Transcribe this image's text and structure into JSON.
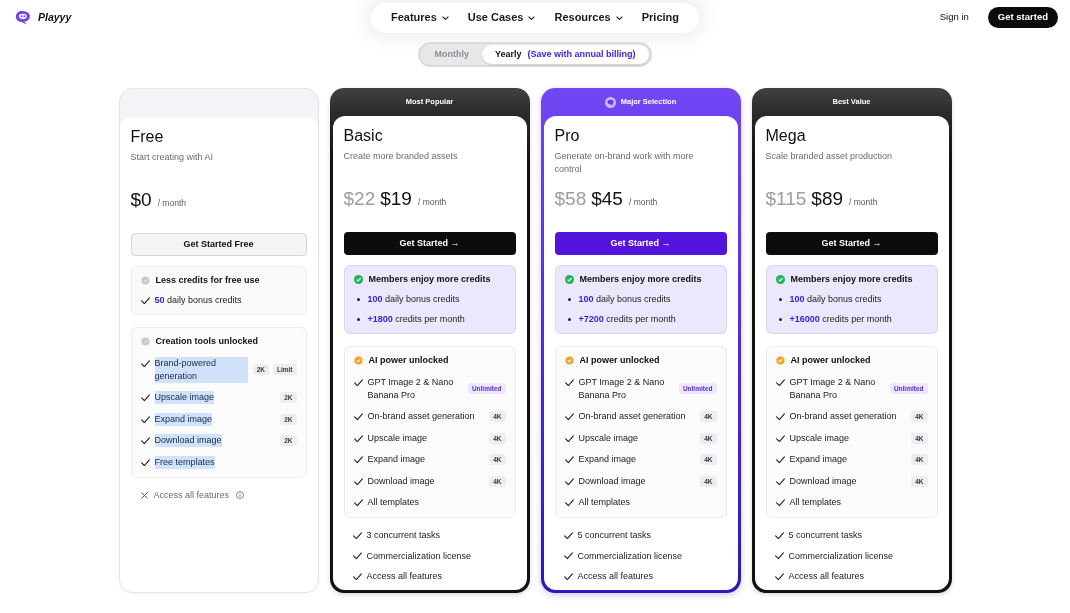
{
  "brand": {
    "name": "Playyy"
  },
  "nav": [
    {
      "label": "Features",
      "has_menu": true
    },
    {
      "label": "Use Cases",
      "has_menu": true
    },
    {
      "label": "Resources",
      "has_menu": true
    },
    {
      "label": "Pricing",
      "has_menu": false
    }
  ],
  "sign_in": "Sign in",
  "get_started": "Get started",
  "billing": [
    {
      "label": "Monthly",
      "selected": false
    },
    {
      "label": "Yearly",
      "note": "(Save with annual billing)",
      "selected": true
    }
  ],
  "plans": [
    {
      "kind": "free",
      "name": "Free",
      "tagline": "Start creating with AI",
      "price": "$0",
      "period": "/ month",
      "button": "Get Started Free",
      "credits": {
        "enabled": false,
        "title": "Less credits for free use",
        "items": [
          "**50** daily bonus credits"
        ]
      },
      "features": {
        "enabled": false,
        "title": "Creation tools unlocked",
        "items": [
          {
            "label": "Brand-powered generation",
            "highlighted": true,
            "tags": [
              {
                "label": "2K",
                "kind": "plain"
              },
              {
                "label": "Limit",
                "kind": "plain"
              }
            ]
          },
          {
            "label": "Upscale image",
            "highlighted": true,
            "tags": [
              {
                "label": "2K",
                "kind": "plain"
              }
            ]
          },
          {
            "label": "Expand image",
            "highlighted": true,
            "tags": [
              {
                "label": "2K",
                "kind": "plain"
              }
            ]
          },
          {
            "label": "Download image",
            "highlighted": true,
            "tags": [
              {
                "label": "2K",
                "kind": "plain"
              }
            ]
          },
          {
            "label": "Free templates",
            "highlighted": true
          }
        ]
      },
      "extras": [
        {
          "label": "Access all features",
          "included": false,
          "has_info": true
        }
      ]
    },
    {
      "kind": "dark",
      "banner": "Most Popular",
      "name": "Basic",
      "tagline": "Create more branded assets",
      "old_price": "$22",
      "price": "$19",
      "period": "/ month",
      "button": "Get Started →",
      "credits": {
        "enabled": true,
        "title": "Members enjoy more credits",
        "items": [
          "**100** daily bonus credits",
          "**+1800** credits per month"
        ]
      },
      "features": {
        "enabled": true,
        "title": "AI power unlocked",
        "items": [
          {
            "label": "GPT Image 2 & Nano Banana Pro",
            "tags": [
              {
                "label": "Unlimited",
                "kind": "accent"
              }
            ]
          },
          {
            "label": "On-brand asset generation",
            "tags": [
              {
                "label": "4K",
                "kind": "plain"
              }
            ]
          },
          {
            "label": "Upscale image",
            "tags": [
              {
                "label": "4K",
                "kind": "plain"
              }
            ]
          },
          {
            "label": "Expand image",
            "tags": [
              {
                "label": "4K",
                "kind": "plain"
              }
            ]
          },
          {
            "label": "Download image",
            "tags": [
              {
                "label": "4K",
                "kind": "plain"
              }
            ]
          },
          {
            "label": "All templates"
          }
        ]
      },
      "extras": [
        {
          "label": "3 concurrent tasks",
          "included": true
        },
        {
          "label": "Commercialization license",
          "included": true
        },
        {
          "label": "Access all features",
          "included": true
        }
      ]
    },
    {
      "kind": "featured",
      "banner": "Major Selection",
      "name": "Pro",
      "tagline": "Generate on-brand work with more control",
      "old_price": "$58",
      "price": "$45",
      "period": "/ month",
      "button": "Get Started →",
      "credits": {
        "enabled": true,
        "title": "Members enjoy more credits",
        "items": [
          "**100** daily bonus credits",
          "**+7200** credits per month"
        ]
      },
      "features": {
        "enabled": true,
        "title": "AI power unlocked",
        "items": [
          {
            "label": "GPT Image 2 & Nano Banana Pro",
            "tags": [
              {
                "label": "Unlimited",
                "kind": "accent"
              }
            ]
          },
          {
            "label": "On-brand asset generation",
            "tags": [
              {
                "label": "4K",
                "kind": "plain"
              }
            ]
          },
          {
            "label": "Upscale image",
            "tags": [
              {
                "label": "4K",
                "kind": "plain"
              }
            ]
          },
          {
            "label": "Expand image",
            "tags": [
              {
                "label": "4K",
                "kind": "plain"
              }
            ]
          },
          {
            "label": "Download image",
            "tags": [
              {
                "label": "4K",
                "kind": "plain"
              }
            ]
          },
          {
            "label": "All templates"
          }
        ]
      },
      "extras": [
        {
          "label": "5 concurrent tasks",
          "included": true
        },
        {
          "label": "Commercialization license",
          "included": true
        },
        {
          "label": "Access all features",
          "included": true
        }
      ]
    },
    {
      "kind": "dark",
      "banner": "Best Value",
      "name": "Mega",
      "tagline": "Scale branded asset production",
      "old_price": "$115",
      "price": "$89",
      "period": "/ month",
      "button": "Get Started →",
      "credits": {
        "enabled": true,
        "title": "Members enjoy more credits",
        "items": [
          "**100** daily bonus credits",
          "**+16000** credits per month"
        ]
      },
      "features": {
        "enabled": true,
        "title": "AI power unlocked",
        "items": [
          {
            "label": "GPT Image 2 & Nano Banana Pro",
            "tags": [
              {
                "label": "Unlimited",
                "kind": "accent"
              }
            ]
          },
          {
            "label": "On-brand asset generation",
            "tags": [
              {
                "label": "4K",
                "kind": "plain"
              }
            ]
          },
          {
            "label": "Upscale image",
            "tags": [
              {
                "label": "4K",
                "kind": "plain"
              }
            ]
          },
          {
            "label": "Expand image",
            "tags": [
              {
                "label": "4K",
                "kind": "plain"
              }
            ]
          },
          {
            "label": "Download image",
            "tags": [
              {
                "label": "4K",
                "kind": "plain"
              }
            ]
          },
          {
            "label": "All templates"
          }
        ]
      },
      "extras": [
        {
          "label": "5 concurrent tasks",
          "included": true
        },
        {
          "label": "Commercialization license",
          "included": true
        },
        {
          "label": "Access all features",
          "included": true
        }
      ]
    }
  ]
}
